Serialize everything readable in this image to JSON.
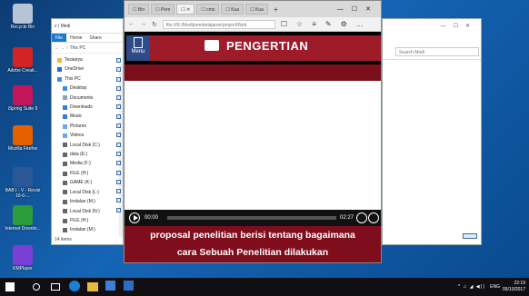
{
  "desktop": {
    "icons": [
      {
        "label": "Recycle Bin",
        "color": "#b7c4d6"
      },
      {
        "label": "Adobe Creati...",
        "color": "#d42323"
      },
      {
        "label": "iSpring Suite 9",
        "color": "#c4165a"
      },
      {
        "label": "Mozilla Firefox",
        "color": "#e66000"
      },
      {
        "label": "BAB I - V - Revisi 16-6-...",
        "color": "#2b5797"
      },
      {
        "label": "Internet Downlo...",
        "color": "#2a9d3a"
      },
      {
        "label": "KMPlayer",
        "color": "#7c3fd6"
      }
    ]
  },
  "explorer": {
    "title": "v | Medi",
    "tabs": [
      "File",
      "Home",
      "Share"
    ],
    "nav": "← → ↑  This PC",
    "tree": [
      {
        "label": "Tesianya",
        "icon": "folder-icon",
        "color": "#e8b93a"
      },
      {
        "label": "OneDrive",
        "icon": "cloud-icon",
        "color": "#1e6fd0"
      },
      {
        "label": "This PC",
        "icon": "computer-icon",
        "color": "#3b8fe0"
      },
      {
        "label": "Desktop",
        "icon": "desktop-icon",
        "color": "#3b8fe0"
      },
      {
        "label": "Documents",
        "icon": "documents-icon",
        "color": "#8da2b8"
      },
      {
        "label": "Downloads",
        "icon": "downloads-icon",
        "color": "#2f7fd8"
      },
      {
        "label": "Music",
        "icon": "music-icon",
        "color": "#2f7fd8"
      },
      {
        "label": "Pictures",
        "icon": "pictures-icon",
        "color": "#6aa8e8"
      },
      {
        "label": "Videos",
        "icon": "videos-icon",
        "color": "#6aa8e8"
      },
      {
        "label": "Local Disk (C:)",
        "icon": "drive-icon",
        "color": "#666"
      },
      {
        "label": "data (E:)",
        "icon": "drive-icon",
        "color": "#666"
      },
      {
        "label": "Media (F:)",
        "icon": "drive-icon",
        "color": "#666"
      },
      {
        "label": "FILE (H:)",
        "icon": "drive-icon",
        "color": "#666"
      },
      {
        "label": "GAME (K:)",
        "icon": "drive-icon",
        "color": "#666"
      },
      {
        "label": "Local Disk (L:)",
        "icon": "drive-icon",
        "color": "#666"
      },
      {
        "label": "Instalan (M:)",
        "icon": "drive-icon",
        "color": "#666"
      },
      {
        "label": "Local Disk (N:)",
        "icon": "drive-icon",
        "color": "#666"
      },
      {
        "label": "FILE (H:)",
        "icon": "drive-icon",
        "color": "#666"
      },
      {
        "label": "Instalan (M:)",
        "icon": "drive-icon",
        "color": "#666"
      }
    ],
    "status": "14 items"
  },
  "rightwin": {
    "search_placeholder": "Search Medi"
  },
  "browser": {
    "tabs": [
      "Bin",
      "Pem",
      "",
      "cms",
      "Kua",
      "Kua"
    ],
    "address": "file:///E:/Medi/pembelajaran/project/Web",
    "page": {
      "menu_label": "Menu",
      "title": "PENGERTIAN",
      "video": {
        "time_current": "00:00",
        "time_total": "02:27",
        "progress": 0
      },
      "caption_line1": "proposal penelitian  berisi tentang bagaimana",
      "caption_line2": "cara Sebuah Penelitian dilakukan"
    }
  },
  "taskbar": {
    "time": "22:19",
    "date": "05/10/2017",
    "lang": "ENG",
    "tray": "^ ♫ ◢ ◀))"
  }
}
